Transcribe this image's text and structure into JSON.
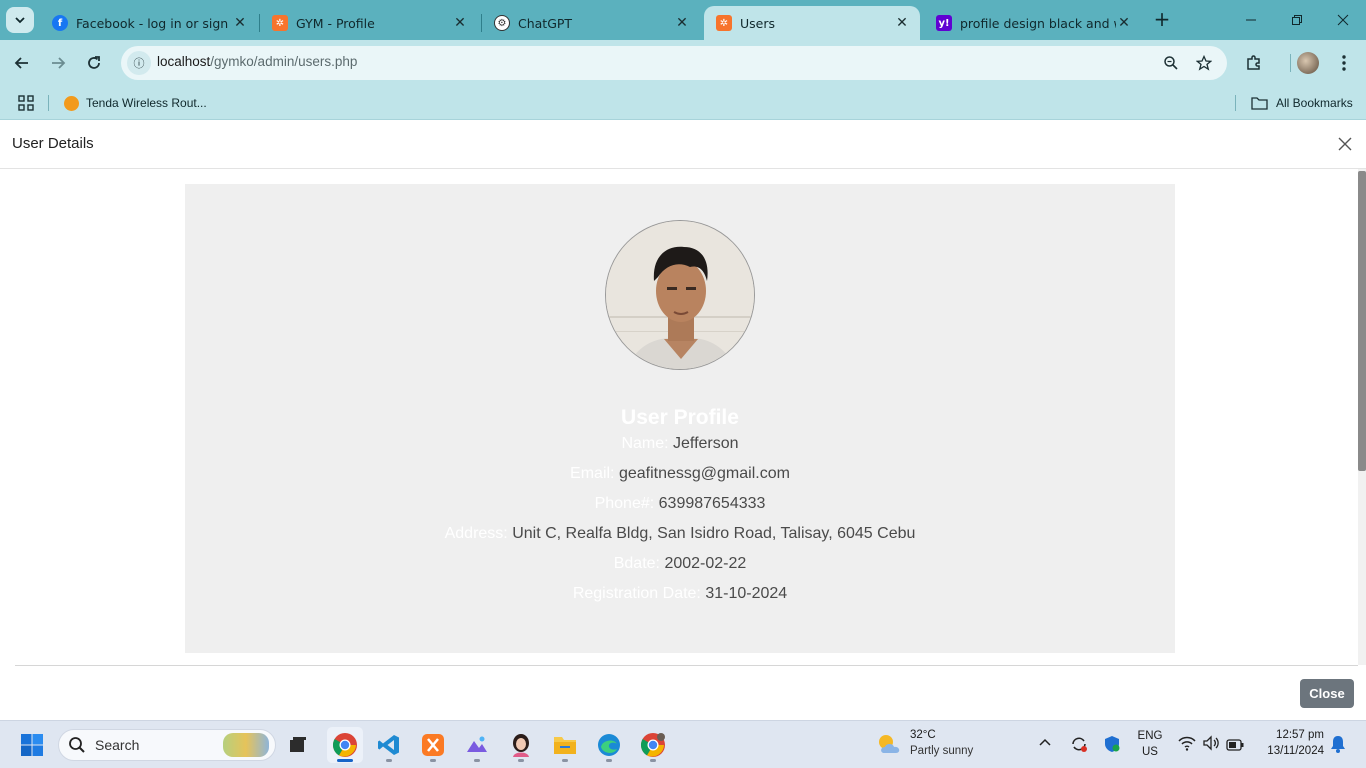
{
  "browser": {
    "tabs": [
      {
        "title": "Facebook - log in or sign up",
        "icon": "facebook-icon"
      },
      {
        "title": "GYM - Profile",
        "icon": "xampp-icon"
      },
      {
        "title": "ChatGPT",
        "icon": "chatgpt-icon"
      },
      {
        "title": "Users",
        "icon": "xampp-icon",
        "active": true
      },
      {
        "title": "profile design black and whi",
        "icon": "yahoo-icon"
      }
    ],
    "url_host": "localhost",
    "url_path": "/gymko/admin/users.php",
    "bookmarks": {
      "item": "Tenda Wireless Rout...",
      "all": "All Bookmarks"
    }
  },
  "modal": {
    "title": "User Details",
    "heading": "User Profile",
    "fields": [
      {
        "label": "Name:",
        "value": "Jefferson"
      },
      {
        "label": "Email:",
        "value": "geafitnessg@gmail.com"
      },
      {
        "label": "Phone#:",
        "value": "639987654333"
      },
      {
        "label": "Address:",
        "value": "Unit C, Realfa Bldg, San Isidro Road, Talisay, 6045 Cebu"
      },
      {
        "label": "Bdate:",
        "value": "2002-02-22"
      },
      {
        "label": "Registration Date:",
        "value": "31-10-2024"
      }
    ],
    "close_label": "Close"
  },
  "taskbar": {
    "search_placeholder": "Search",
    "weather_temp": "32°C",
    "weather_desc": "Partly sunny",
    "lang_top": "ENG",
    "lang_bottom": "US",
    "time": "12:57 pm",
    "date": "13/11/2024"
  },
  "colors": {
    "tabstrip": "#5bb1be",
    "toolbar": "#bfe4e9",
    "card": "#efefef",
    "close_button": "#6c757d"
  }
}
